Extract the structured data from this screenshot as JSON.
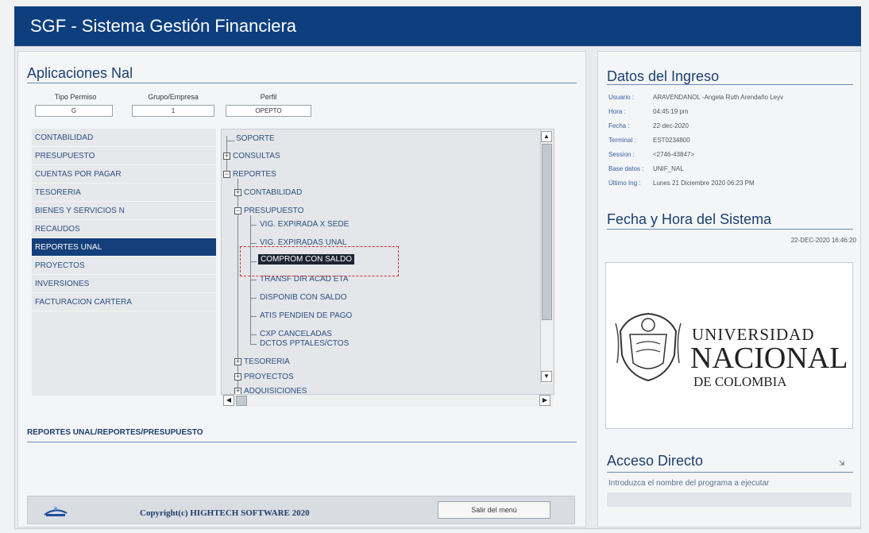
{
  "app": {
    "title": "SGF - Sistema Gestión Financiera"
  },
  "left": {
    "section_title": "Aplicaciones Nal",
    "fields": [
      {
        "label": "Tipo Permiso",
        "value": "G"
      },
      {
        "label": "Grupo/Empresa",
        "value": "1"
      },
      {
        "label": "Perfil",
        "value": "OPEPTO"
      }
    ],
    "menu": [
      "CONTABILIDAD",
      "PRESUPUESTO",
      "CUENTAS POR PAGAR",
      "TESORERIA",
      "BIENES Y SERVICIOS N",
      "RECAUDOS",
      "REPORTES UNAL",
      "PROYECTOS",
      "INVERSIONES",
      "FACTURACION CARTERA"
    ],
    "active_menu": "REPORTES UNAL",
    "tree": {
      "soporte": "SOPORTE",
      "consultas": "CONSULTAS",
      "reportes": "REPORTES",
      "contabilidad": "CONTABILIDAD",
      "presupuesto": "PRESUPUESTO",
      "items": [
        "VIG. EXPIRADA X SEDE",
        "VIG. EXPIRADAS UNAL",
        "COMPROM CON SALDO",
        "TRANSF DIR ACAD ETA",
        "DISPONIB CON SALDO",
        "ATIS PENDIEN DE PAGO",
        "CXP CANCELADAS",
        "DCTOS PPTALES/CTOS"
      ],
      "tesoreria": "TESORERIA",
      "proyectos": "PROYECTOS",
      "adquisiciones": "ADQUISICIONES"
    },
    "path": "REPORTES UNAL/REPORTES/PRESUPUESTO",
    "copyright": "Copyright(c) HIGHTECH SOFTWARE 2020",
    "exit_label": "Salir del menú"
  },
  "right": {
    "ingreso_title": "Datos del Ingreso",
    "rows": [
      {
        "label": "Usuario :",
        "value": "ARAVENDANOL -Angela Ruth Arendaño Leyv"
      },
      {
        "label": "Hora :",
        "value": "04:45:19 pm"
      },
      {
        "label": "Fecha :",
        "value": "22-dec-2020"
      },
      {
        "label": "Terminal :",
        "value": "EST0234800"
      },
      {
        "label": "Session :",
        "value": "<2746-43847>"
      },
      {
        "label": "Base datos :",
        "value": "UNIF_NAL"
      },
      {
        "label": "Último Ing :",
        "value": "Lunes    21 Diciembre 2020 06:23 PM"
      }
    ],
    "system_title": "Fecha y Hora del Sistema",
    "system_datetime": "22-DEC-2020 16:46:20",
    "university": {
      "line1": "UNIVERSIDAD",
      "line2": "NACIONAL",
      "line3": "DE COLOMBIA"
    },
    "acceso_title": "Acceso Directo",
    "acceso_hint": "Introduzca el nombre del programa a ejecutar"
  }
}
